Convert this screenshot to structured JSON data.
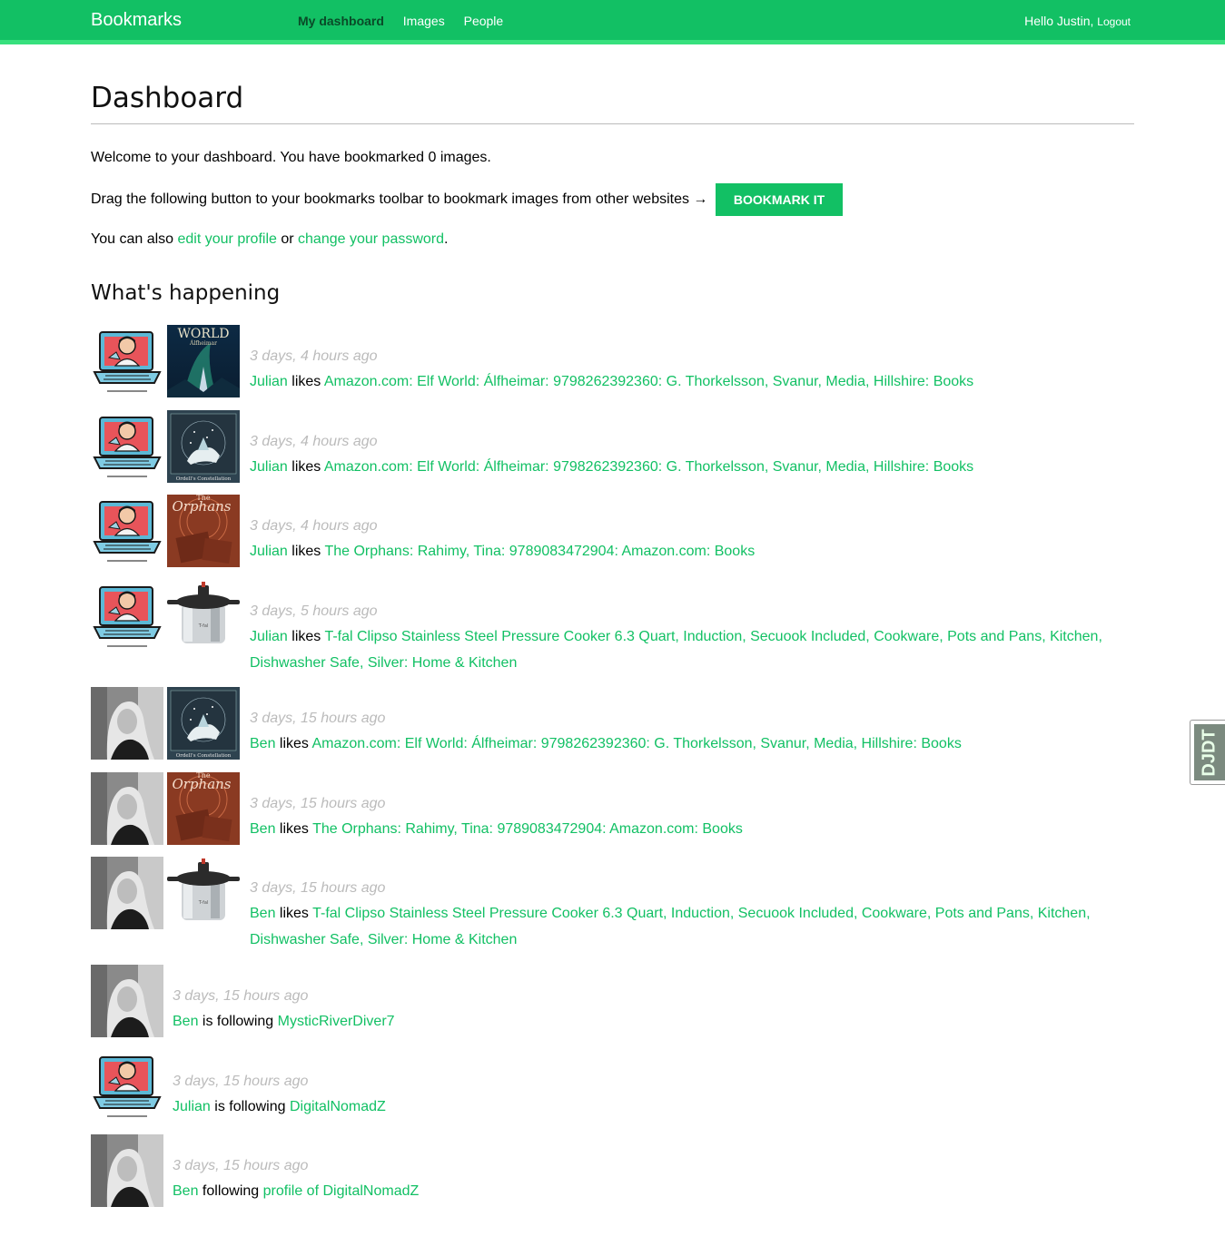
{
  "header": {
    "logo": "Bookmarks",
    "menu": [
      {
        "label": "My dashboard",
        "selected": true
      },
      {
        "label": "Images",
        "selected": false
      },
      {
        "label": "People",
        "selected": false
      }
    ],
    "greeting": "Hello Justin,",
    "logout": "Logout"
  },
  "page": {
    "title": "Dashboard",
    "welcome": "Welcome to your dashboard. You have bookmarked 0 images.",
    "drag_text": "Drag the following button to your bookmarks toolbar to bookmark images from other websites →",
    "bookmark_button": "BOOKMARK IT",
    "also_prefix": "You can also",
    "edit_profile": "edit your profile",
    "or": "or",
    "change_password": "change your password",
    "period": ".",
    "happening_title": "What's happening"
  },
  "actions": [
    {
      "date": "3 days, 4 hours ago",
      "user": "Julian",
      "verb": "likes",
      "target": "Amazon.com: Elf World: Álfheimar: 9798262392360: G. Thorkelsson, Svanur, Media, Hillshire: Books",
      "user_avatar": "laptop-man",
      "target_image": "elf-world-cover"
    },
    {
      "date": "3 days, 4 hours ago",
      "user": "Julian",
      "verb": "likes",
      "target": "Amazon.com: Elf World: Álfheimar: 9798262392360: G. Thorkelsson, Svanur, Media, Hillshire: Books",
      "user_avatar": "laptop-man",
      "target_image": "constellation-cover"
    },
    {
      "date": "3 days, 4 hours ago",
      "user": "Julian",
      "verb": "likes",
      "target": "The Orphans: Rahimy, Tina: 9789083472904: Amazon.com: Books",
      "user_avatar": "laptop-man",
      "target_image": "orphans-cover"
    },
    {
      "date": "3 days, 5 hours ago",
      "user": "Julian",
      "verb": "likes",
      "target": "T-fal Clipso Stainless Steel Pressure Cooker 6.3 Quart, Induction, Secuook Included, Cookware, Pots and Pans, Kitchen, Dishwasher Safe, Silver: Home & Kitchen",
      "user_avatar": "laptop-man",
      "target_image": "pressure-cooker"
    },
    {
      "date": "3 days, 15 hours ago",
      "user": "Ben",
      "verb": "likes",
      "target": "Amazon.com: Elf World: Álfheimar: 9798262392360: G. Thorkelsson, Svanur, Media, Hillshire: Books",
      "user_avatar": "bw-portrait",
      "target_image": "constellation-cover"
    },
    {
      "date": "3 days, 15 hours ago",
      "user": "Ben",
      "verb": "likes",
      "target": "The Orphans: Rahimy, Tina: 9789083472904: Amazon.com: Books",
      "user_avatar": "bw-portrait",
      "target_image": "orphans-cover"
    },
    {
      "date": "3 days, 15 hours ago",
      "user": "Ben",
      "verb": "likes",
      "target": "T-fal Clipso Stainless Steel Pressure Cooker 6.3 Quart, Induction, Secuook Included, Cookware, Pots and Pans, Kitchen, Dishwasher Safe, Silver: Home & Kitchen",
      "user_avatar": "bw-portrait",
      "target_image": "pressure-cooker"
    },
    {
      "date": "3 days, 15 hours ago",
      "user": "Ben",
      "verb": "is following",
      "target": "MysticRiverDiver7",
      "user_avatar": "bw-portrait",
      "target_image": ""
    },
    {
      "date": "3 days, 15 hours ago",
      "user": "Julian",
      "verb": "is following",
      "target": "DigitalNomadZ",
      "user_avatar": "laptop-man",
      "target_image": ""
    },
    {
      "date": "3 days, 15 hours ago",
      "user": "Ben",
      "verb": "following",
      "target": "profile of DigitalNomadZ",
      "user_avatar": "bw-portrait",
      "target_image": ""
    }
  ],
  "image_texts": {
    "elf_world": "WORLD",
    "elf_sub": "Álfheimar",
    "constellation": "Ordell's Constellation",
    "orphans": "Orphans",
    "orphans_top": "The",
    "cooker_brand": "T-fal"
  },
  "widget": {
    "label": "DJDT"
  },
  "colors": {
    "accent": "#12c064",
    "accent_light": "#37e07d",
    "date": "#bbbbbb"
  }
}
